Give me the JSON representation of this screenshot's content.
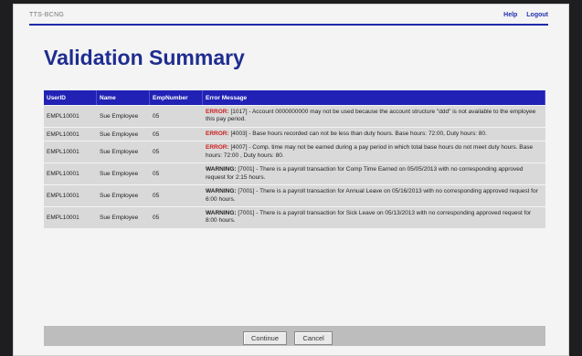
{
  "header": {
    "system_name": "TTS-BCNG",
    "links": [
      "Help",
      "Logout"
    ]
  },
  "page_title": "Validation Summary",
  "table": {
    "columns": [
      "UserID",
      "Name",
      "EmpNumber",
      "Error Message"
    ],
    "rows": [
      {
        "user_id": "EMPL10001",
        "name": "Sue Employee",
        "emp_no": "05",
        "level": "ERROR:",
        "level_type": "error",
        "message": "[1017] - Account 0000000000 may not be used because the account structure \"ddd\" is not available to the employee this pay period."
      },
      {
        "user_id": "EMPL10001",
        "name": "Sue Employee",
        "emp_no": "05",
        "level": "ERROR:",
        "level_type": "error",
        "message": "[4003] - Base hours recorded can not be less than duty hours. Base hours: 72:00, Duty hours: 80."
      },
      {
        "user_id": "EMPL10001",
        "name": "Sue Employee",
        "emp_no": "05",
        "level": "ERROR:",
        "level_type": "error",
        "message": "[4007] - Comp. time may not be earned during a pay period in which total base hours do not meet duty hours. Base hours: 72:00 , Duty hours: 80."
      },
      {
        "user_id": "EMPL10001",
        "name": "Sue Employee",
        "emp_no": "05",
        "level": "WARNING:",
        "level_type": "warning",
        "message": "[7001] - There is a payroll transaction for Comp Time Earned on 05/05/2013 with no corresponding approved request for 2:15 hours."
      },
      {
        "user_id": "EMPL10001",
        "name": "Sue Employee",
        "emp_no": "05",
        "level": "WARNING:",
        "level_type": "warning",
        "message": "[7001] - There is a payroll transaction for Annual Leave on 05/16/2013 with no corresponding approved request for 6:00 hours."
      },
      {
        "user_id": "EMPL10001",
        "name": "Sue Employee",
        "emp_no": "05",
        "level": "WARNING:",
        "level_type": "warning",
        "message": "[7001] - There is a payroll transaction for Sick Leave on 05/13/2013 with no corresponding approved request for 8:00 hours."
      }
    ]
  },
  "buttons": {
    "continue_label": "Continue",
    "cancel_label": "Cancel"
  },
  "colors": {
    "header_blue": "#2122b5",
    "title_blue": "#1f2d8f",
    "error_red": "#cc2020"
  }
}
